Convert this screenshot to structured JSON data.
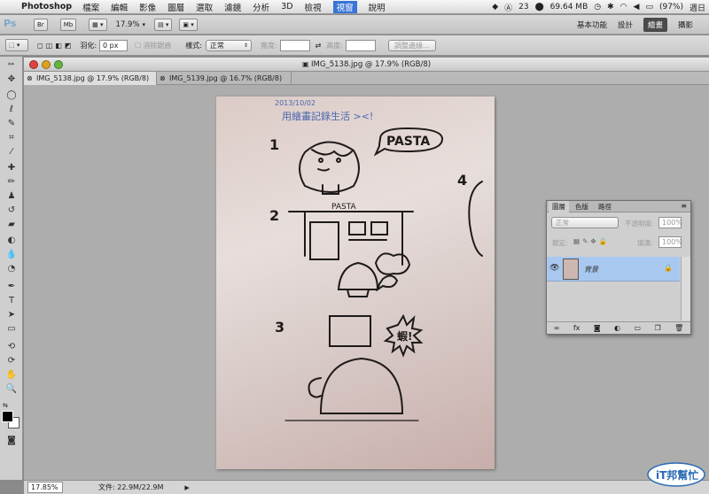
{
  "menubar": {
    "app_name": "Photoshop",
    "items": [
      "檔案",
      "編輯",
      "影像",
      "圖層",
      "選取",
      "濾鏡",
      "分析",
      "3D",
      "檢視",
      "視窗",
      "說明"
    ],
    "active_item": "視窗",
    "status": {
      "adobe_count": "23",
      "network_speed": "69.64 MB",
      "battery": "(97%)",
      "day": "週日"
    }
  },
  "appbar": {
    "zoom": "17.9%",
    "btn_br": "Br",
    "btn_mb": "Mb",
    "workspaces": [
      "基本功能",
      "設計",
      "繪畫",
      "攝影"
    ],
    "active_workspace": "繪畫"
  },
  "options": {
    "feather_label": "羽化:",
    "feather_value": "0 px",
    "antialias_label": "消除鋸齒",
    "style_label": "樣式:",
    "style_value": "正常",
    "width_label": "寬度:",
    "height_label": "高度:",
    "refine_edge": "調整邊緣..."
  },
  "document": {
    "title": "IMG_5138.jpg @ 17.9% (RGB/8)",
    "tabs": [
      {
        "label": "IMG_5138.jpg @ 17.9% (RGB/8)",
        "active": true
      },
      {
        "label": "IMG_5139.jpg @ 16.7% (RGB/8)",
        "active": false
      }
    ],
    "canvas_text": {
      "date": "2013/10/02",
      "subtitle": "用繪畫記錄生活 ><!",
      "pasta_bubble": "PASTA",
      "pasta_sign": "PASTA",
      "num1": "1",
      "num2": "2",
      "num3": "3",
      "num4": "4",
      "shrimp": "蝦!"
    }
  },
  "status": {
    "zoom": "17.85%",
    "file_info": "文件: 22.9M/22.9M"
  },
  "layers": {
    "tabs": [
      "圖層",
      "色版",
      "路徑"
    ],
    "active_tab": "圖層",
    "blend_mode": "正常",
    "opacity_label": "不透明度:",
    "opacity_value": "100%",
    "lock_label": "鎖定:",
    "fill_label": "填滿:",
    "fill_value": "100%",
    "layer_name": "背景"
  },
  "watermark": {
    "text": "iT邦幫忙"
  },
  "colors": {
    "selection": "#3875d7",
    "layer_highlight": "#a9c8ef",
    "workspace": "#8a8a8a"
  }
}
